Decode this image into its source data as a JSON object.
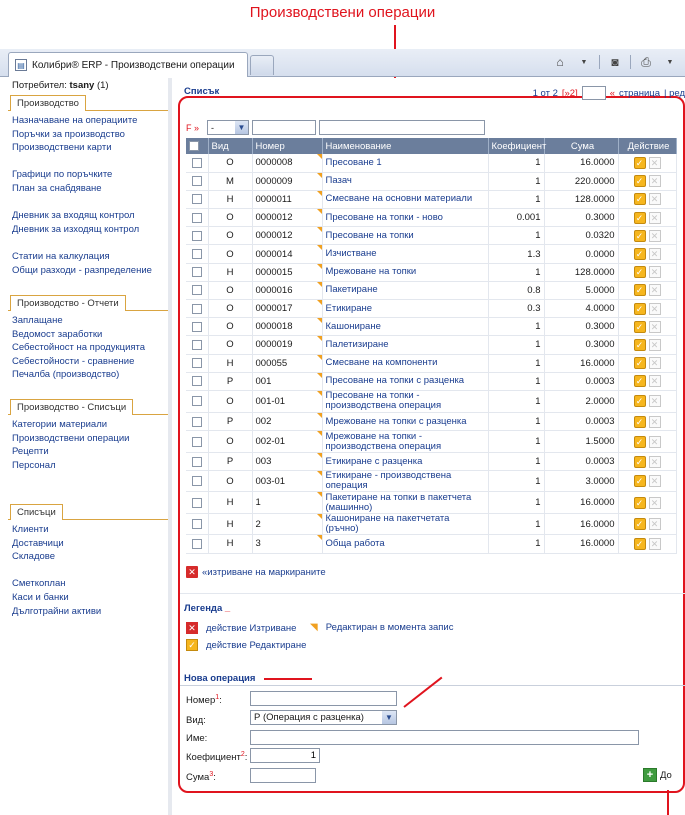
{
  "callout": {
    "title": "Производствени операции"
  },
  "browser": {
    "tab_title": "Колибри® ERP - Производствени операции",
    "favicon": "page-icon",
    "toolbar_icons": [
      "home-icon",
      "feed-icon",
      "print-icon"
    ]
  },
  "sidebar": {
    "user_label": "Потребител:",
    "user_name": "tsany",
    "user_count": "(1)",
    "groups": [
      {
        "title": "Производство",
        "items": [
          "Назначаване на операциите",
          "Поръчки за производство",
          "Производствени карти",
          "",
          "Графици по поръчките",
          "План за снабдяване",
          "",
          "Дневник за входящ контрол",
          "Дневник за изходящ контрол",
          "",
          "Статии на калкулация",
          "Общи разходи - разпределение"
        ]
      },
      {
        "title": "Производство - Отчети",
        "items": [
          "Заплащане",
          "Ведомост заработки",
          "Себестойност на продукцията",
          "Себестойности - сравнение",
          "Печалба (производство)"
        ]
      },
      {
        "title": "Производство - Списъци",
        "items": [
          "Категории материали",
          "Производствени операции",
          "Рецепти",
          "Персонал"
        ]
      },
      {
        "title": "Списъци",
        "items": [
          "Клиенти",
          "Доставчици",
          "Складове",
          "",
          "Сметкоплан",
          "Каси и банки",
          "Дълготрайни активи"
        ]
      }
    ]
  },
  "main": {
    "list_title": "Списък",
    "pager": {
      "text": "1 от 2",
      "next": "[»2]",
      "page_label": "«страница",
      "tail": "| ред"
    },
    "filter": {
      "label": "F »",
      "select_value": "-"
    },
    "columns": [
      "Вид",
      "Номер",
      "Наименование",
      "Коефициент",
      "Сума",
      "Действие"
    ],
    "rows": [
      {
        "vid": "О",
        "num": "0000008",
        "name": "Пресоване 1",
        "coef": "1",
        "sum": "16.0000"
      },
      {
        "vid": "М",
        "num": "0000009",
        "name": "Пазач",
        "coef": "1",
        "sum": "220.0000"
      },
      {
        "vid": "Н",
        "num": "0000011",
        "name": "Смесване на основни материали",
        "coef": "1",
        "sum": "128.0000"
      },
      {
        "vid": "О",
        "num": "0000012",
        "name": "Пресоване на топки - ново",
        "coef": "0.001",
        "sum": "0.3000"
      },
      {
        "vid": "О",
        "num": "0000012",
        "name": "Пресоване на топки",
        "coef": "1",
        "sum": "0.0320"
      },
      {
        "vid": "О",
        "num": "0000014",
        "name": "Изчистване",
        "coef": "1.3",
        "sum": "0.0000"
      },
      {
        "vid": "Н",
        "num": "0000015",
        "name": "Мрежоване на топки",
        "coef": "1",
        "sum": "128.0000"
      },
      {
        "vid": "О",
        "num": "0000016",
        "name": "Пакетиране",
        "coef": "0.8",
        "sum": "5.0000"
      },
      {
        "vid": "О",
        "num": "0000017",
        "name": "Етикиране",
        "coef": "0.3",
        "sum": "4.0000"
      },
      {
        "vid": "О",
        "num": "0000018",
        "name": "Кашониране",
        "coef": "1",
        "sum": "0.3000"
      },
      {
        "vid": "О",
        "num": "0000019",
        "name": "Палетизиране",
        "coef": "1",
        "sum": "0.3000"
      },
      {
        "vid": "Н",
        "num": "000055",
        "name": "Смесване на компоненти",
        "coef": "1",
        "sum": "16.0000"
      },
      {
        "vid": "Р",
        "num": "001",
        "name": "Пресоване на топки с разценка",
        "coef": "1",
        "sum": "0.0003"
      },
      {
        "vid": "О",
        "num": "001-01",
        "name": "Пресоване на топки - производствена операция",
        "coef": "1",
        "sum": "2.0000"
      },
      {
        "vid": "Р",
        "num": "002",
        "name": "Мрежоване на топки с разценка",
        "coef": "1",
        "sum": "0.0003"
      },
      {
        "vid": "О",
        "num": "002-01",
        "name": "Мрежоване на топки - производствена операция",
        "coef": "1",
        "sum": "1.5000"
      },
      {
        "vid": "Р",
        "num": "003",
        "name": "Етикиране с разценка",
        "coef": "1",
        "sum": "0.0003"
      },
      {
        "vid": "О",
        "num": "003-01",
        "name": "Етикиране - производствена операция",
        "coef": "1",
        "sum": "3.0000"
      },
      {
        "vid": "Н",
        "num": "1",
        "name": "Пакетиране на топки в пакетчета (машинно)",
        "coef": "1",
        "sum": "16.0000"
      },
      {
        "vid": "Н",
        "num": "2",
        "name": "Кашониране на пакетчетата (ръчно)",
        "coef": "1",
        "sum": "16.0000"
      },
      {
        "vid": "Н",
        "num": "3",
        "name": "Обща работа",
        "coef": "1",
        "sum": "16.0000"
      }
    ],
    "delete_marked": "«изтриване на маркираните",
    "legend": {
      "title": "Легенда",
      "delete_label": "действие Изтриване",
      "edit_label": "действие Редактиране",
      "editing_label": "Редактиран в момента запис"
    },
    "new_op": {
      "title": "Нова операция",
      "number_label": "Номер",
      "number_sup": "1",
      "type_label": "Вид:",
      "type_value": "Р (Операция с разценка)",
      "name_label": "Име:",
      "coef_label": "Коефициент",
      "coef_sup": "2",
      "coef_value": "1",
      "sum_label": "Сума",
      "sum_sup": "3",
      "add_label": "До"
    }
  },
  "colors": {
    "accent_red": "#e0141e",
    "link_blue": "#1a3d8f",
    "header_grey": "#6b7e9c",
    "nav_border": "#d9a441"
  }
}
